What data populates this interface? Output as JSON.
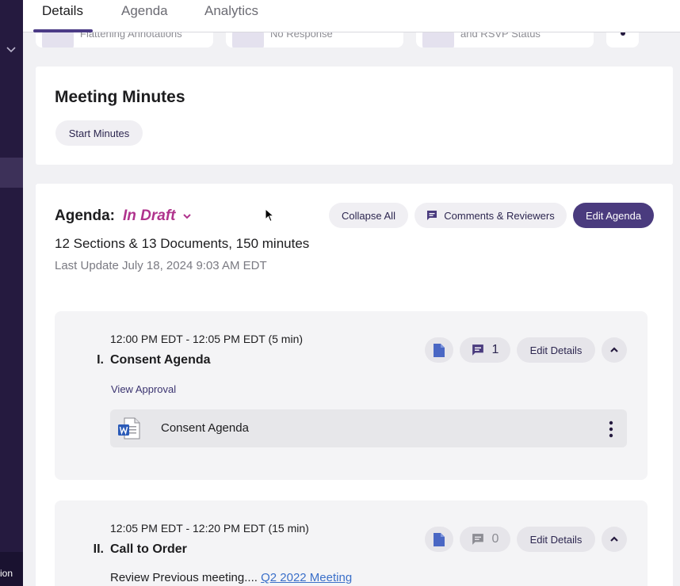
{
  "tabs": [
    {
      "label": "Details",
      "active": true
    },
    {
      "label": "Agenda",
      "active": false
    },
    {
      "label": "Analytics",
      "active": false
    }
  ],
  "summary_cards": [
    {
      "text": "Flattening Annotations"
    },
    {
      "text": "No Response"
    },
    {
      "text": "and RSVP Status"
    }
  ],
  "sidebar": {
    "bottom_label": "ion"
  },
  "minutes": {
    "title": "Meeting Minutes",
    "start_button": "Start Minutes"
  },
  "agenda": {
    "label": "Agenda:",
    "status": "In Draft",
    "status_color": "#b0338d",
    "summary": "12 Sections & 13 Documents, 150 minutes",
    "updated": "Last Update July 18, 2024 9:03 AM EDT",
    "collapse_all": "Collapse All",
    "comments_reviewers": "Comments & Reviewers",
    "edit_agenda": "Edit Agenda"
  },
  "sections": [
    {
      "number": "I.",
      "time": "12:00 PM EDT - 12:05 PM EDT (5 min)",
      "title": "Consent Agenda",
      "comment_count": "1",
      "edit_label": "Edit Details",
      "approval_link": "View Approval",
      "document": {
        "name": "Consent Agenda",
        "icon": "word-doc-icon"
      }
    },
    {
      "number": "II.",
      "time": "12:05 PM EDT - 12:20 PM EDT (15 min)",
      "title": "Call to Order",
      "comment_count": "0",
      "edit_label": "Edit Details",
      "review_text": "Review Previous meeting....",
      "review_link": "Q2 2022 Meeting"
    }
  ],
  "colors": {
    "accent": "#4a3b7e",
    "sidebar": "#251a3f",
    "link": "#3a6fc9"
  }
}
